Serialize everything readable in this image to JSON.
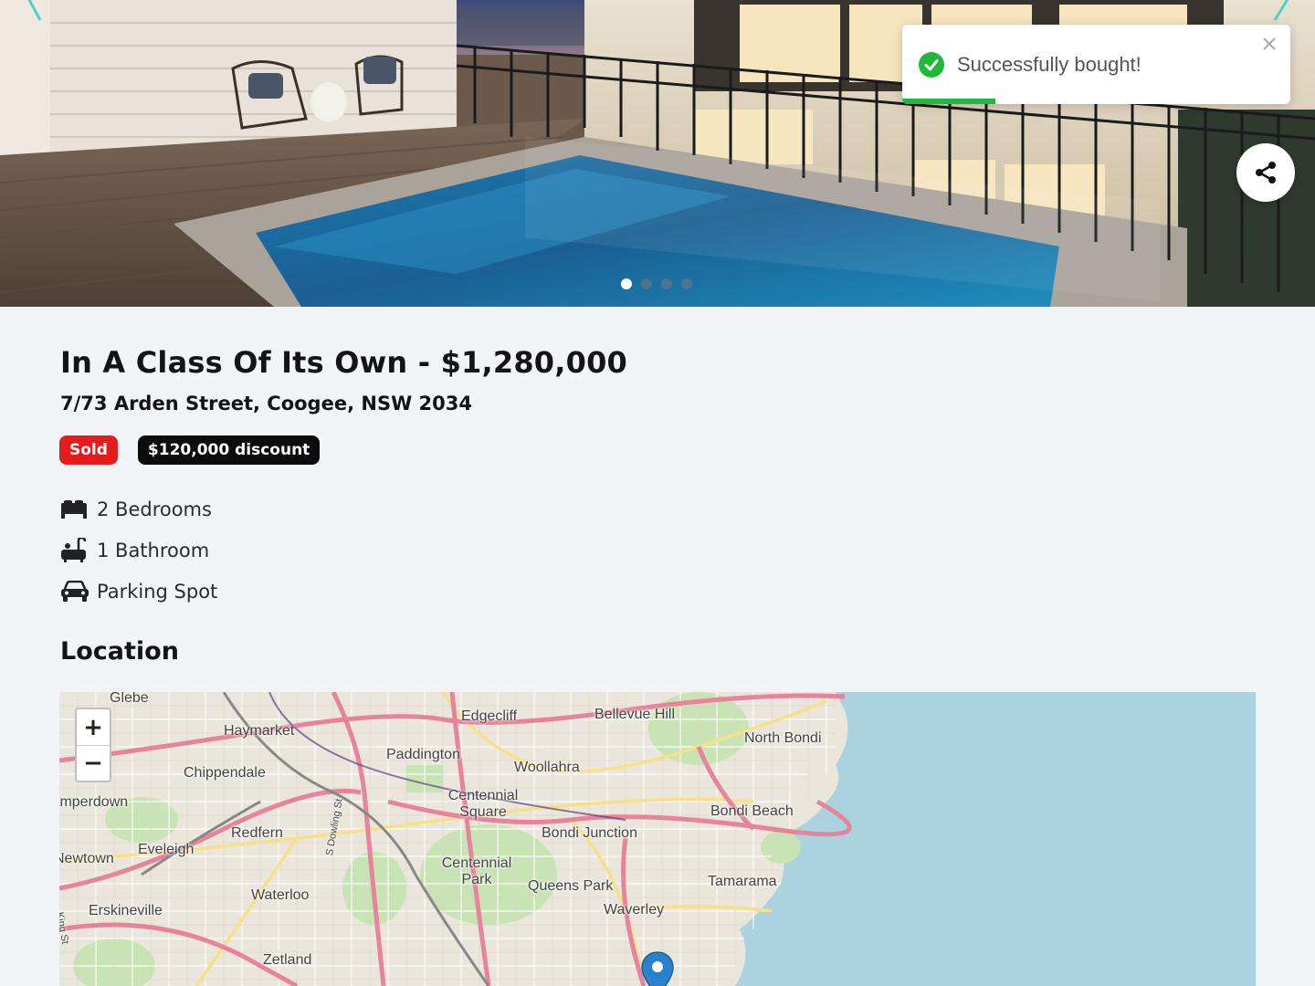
{
  "toast": {
    "message": "Successfully bought!",
    "progress": 0.24,
    "success_color": "#1fb83a"
  },
  "gallery": {
    "slides": 4,
    "active_slide": 1
  },
  "listing": {
    "title": "In A Class Of Its Own - $1,280,000",
    "address": "7/73 Arden Street, Coogee, NSW 2034",
    "badges": {
      "status": "Sold",
      "discount": "$120,000 discount"
    },
    "status_color": "#e61b1b",
    "features": [
      {
        "icon": "bed-icon",
        "label": "2 Bedrooms"
      },
      {
        "icon": "bath-icon",
        "label": "1 Bathroom"
      },
      {
        "icon": "car-icon",
        "label": "Parking Spot"
      }
    ]
  },
  "location": {
    "heading": "Location",
    "zoom_in": "+",
    "zoom_out": "−",
    "places": [
      "Glebe",
      "Haymarket",
      "Edgecliff",
      "Bellevue Hill",
      "North Bondi",
      "Paddington",
      "Woollahra",
      "Chippendale",
      "Camperdown",
      "Centennial Square",
      "Bondi Beach",
      "Bondi Junction",
      "Redfern",
      "Eveleigh",
      "Newtown",
      "Centennial Park",
      "Tamarama",
      "Queens Park",
      "Waterloo",
      "Erskineville",
      "Waverley",
      "Zetland",
      "S Dowling St",
      "King St"
    ]
  }
}
